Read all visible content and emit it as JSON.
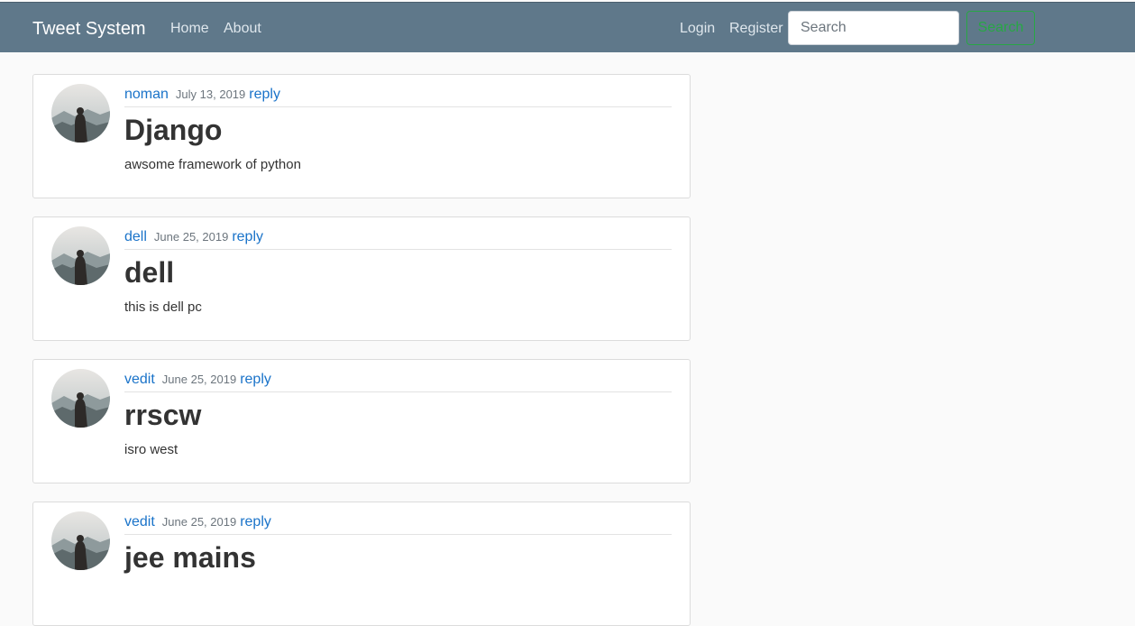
{
  "navbar": {
    "brand": "Tweet System",
    "links": [
      "Home",
      "About"
    ],
    "auth_links": [
      "Login",
      "Register"
    ],
    "search": {
      "placeholder": "Search",
      "value": "",
      "button_label": "Search"
    }
  },
  "colors": {
    "navbar_bg": "#5f788a",
    "link": "#1a73c9",
    "search_button": "#28a745"
  },
  "tweets": [
    {
      "author": "noman",
      "date": "July 13, 2019",
      "reply_label": "reply",
      "title": "Django",
      "body": "awsome framework of python",
      "avatar_icon": "avatar-icon"
    },
    {
      "author": "dell",
      "date": "June 25, 2019",
      "reply_label": "reply",
      "title": "dell",
      "body": "this is dell pc",
      "avatar_icon": "avatar-icon"
    },
    {
      "author": "vedit",
      "date": "June 25, 2019",
      "reply_label": "reply",
      "title": "rrscw",
      "body": "isro west",
      "avatar_icon": "avatar-icon"
    },
    {
      "author": "vedit",
      "date": "June 25, 2019",
      "reply_label": "reply",
      "title": "jee mains",
      "body": "",
      "avatar_icon": "avatar-icon"
    }
  ]
}
